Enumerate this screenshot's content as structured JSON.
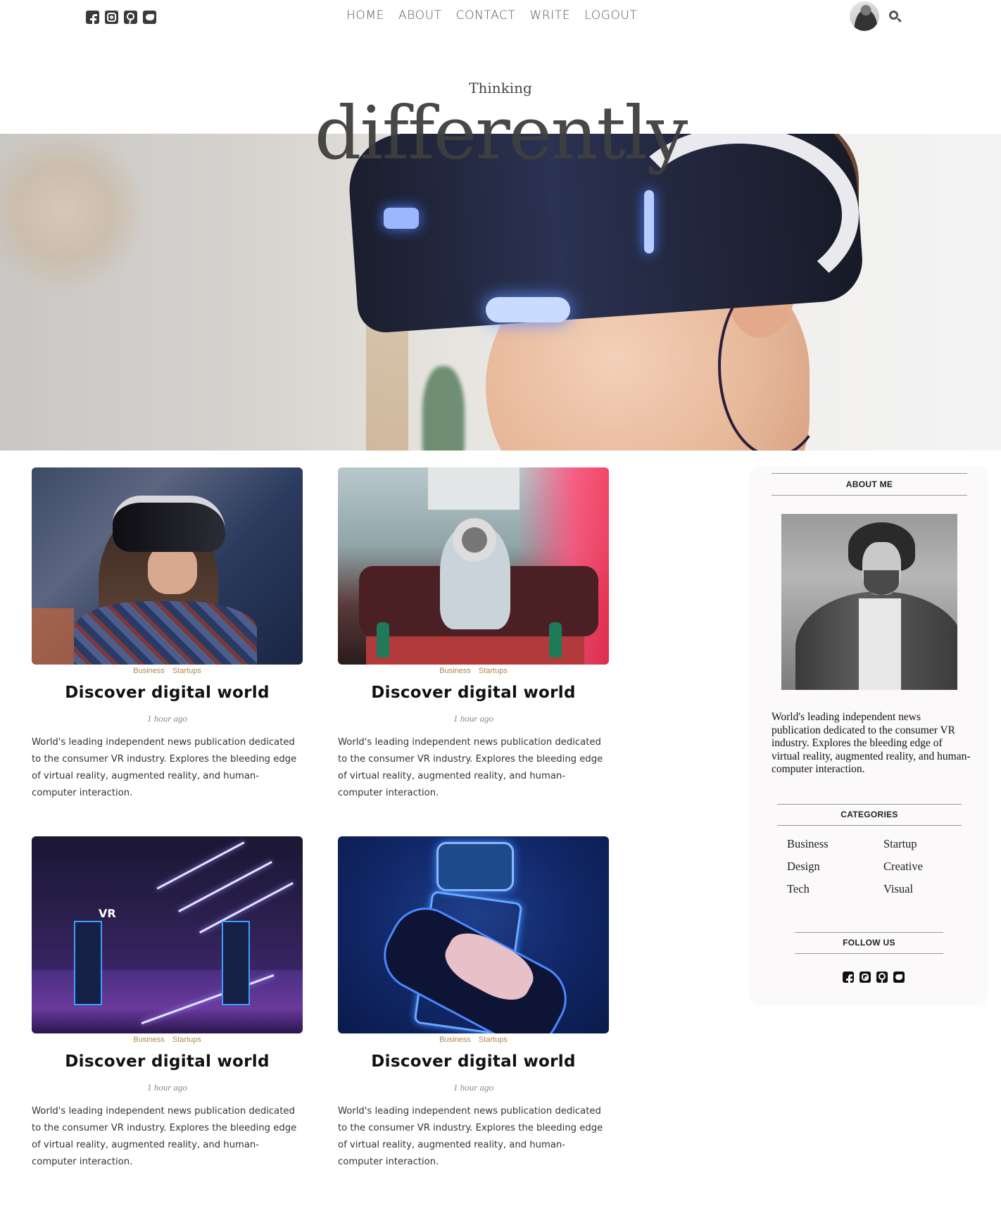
{
  "header": {
    "social_icons": [
      "facebook-icon",
      "instagram-icon",
      "pinterest-icon",
      "twitter-icon"
    ],
    "nav": [
      "HOME",
      "ABOUT",
      "CONTACT",
      "WRITE",
      "LOGOUT"
    ],
    "search_icon": "search-icon"
  },
  "hero": {
    "subtitle": "Thinking",
    "title": "differently"
  },
  "posts": [
    {
      "categories": [
        "Business",
        "Startups"
      ],
      "title": "Discover digital world",
      "time": "1 hour ago",
      "description": "World's leading independent news publication dedicated to the consumer VR industry. Explores the bleeding edge of virtual reality, augmented reality, and human-computer interaction."
    },
    {
      "categories": [
        "Business",
        "Startups"
      ],
      "title": "Discover digital world",
      "time": "1 hour ago",
      "description": "World's leading independent news publication dedicated to the consumer VR industry. Explores the bleeding edge of virtual reality, augmented reality, and human-computer interaction."
    },
    {
      "categories": [
        "Business",
        "Startups"
      ],
      "title": "Discover digital world",
      "time": "1 hour ago",
      "description": "World's leading independent news publication dedicated to the consumer VR industry. Explores the bleeding edge of virtual reality, augmented reality, and human-computer interaction."
    },
    {
      "categories": [
        "Business",
        "Startups"
      ],
      "title": "Discover digital world",
      "time": "1 hour ago",
      "description": "World's leading independent news publication dedicated to the consumer VR industry. Explores the bleeding edge of virtual reality, augmented reality, and human-computer interaction."
    }
  ],
  "sidebar": {
    "about_heading": "ABOUT ME",
    "about_text": "World's leading independent news publication dedicated to the consumer VR industry. Explores the bleeding edge of virtual reality, augmented reality, and human-computer interaction.",
    "categories_heading": "CATEGORIES",
    "categories": [
      "Business",
      "Startup",
      "Design",
      "Creative",
      "Tech",
      "Visual"
    ],
    "follow_heading": "FOLLOW US",
    "social_icons": [
      "facebook-icon",
      "instagram-icon",
      "pinterest-icon",
      "twitter-icon"
    ]
  },
  "colors": {
    "category_accent": "#b08550",
    "nav_text": "#555555",
    "sidebar_bg": "#fbf9f9"
  }
}
